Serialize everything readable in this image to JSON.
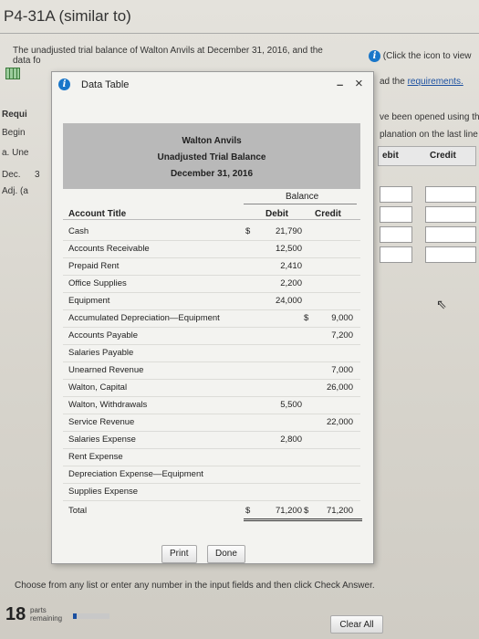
{
  "page": {
    "title": "P4-31A (similar to)",
    "question_line1": "The unadjusted trial balance of Walton Anvils at December 31, 2016, and the",
    "question_line2": "data fo",
    "click_icon_text": "(Click the icon to view",
    "read_prefix": "ad the",
    "requirements_link": "requirements.",
    "opened_text": "ve been opened using th",
    "explanation_text": "planation on the last line",
    "side_requ": "Requi",
    "side_begin": "Begin",
    "side_une": "a. Une",
    "side_dec": "Dec.",
    "side_adj": "Adj. (a",
    "side_num": "3",
    "bg_debit": "ebit",
    "bg_credit": "Credit",
    "instruction": "Choose from any list or enter any number in the input fields and then click Check Answer.",
    "parts_remaining_num": "18",
    "parts_label_1": "parts",
    "parts_label_2": "remaining",
    "progress_fraction": 0.1,
    "clear_all": "Clear All"
  },
  "modal": {
    "title": "Data Table",
    "minimize_icon": "minimize-icon",
    "close_icon": "close-icon",
    "close_glyph": "×",
    "minimize_glyph": "–",
    "company": "Walton Anvils",
    "statement": "Unadjusted Trial Balance",
    "date": "December 31, 2016",
    "balance_label": "Balance",
    "account_title_label": "Account Title",
    "debit_label": "Debit",
    "credit_label": "Credit",
    "currency": "$",
    "rows": [
      {
        "account": "Cash",
        "debit": "21,790",
        "credit": "",
        "debit_cur": true
      },
      {
        "account": "Accounts Receivable",
        "debit": "12,500",
        "credit": ""
      },
      {
        "account": "Prepaid Rent",
        "debit": "2,410",
        "credit": ""
      },
      {
        "account": "Office Supplies",
        "debit": "2,200",
        "credit": ""
      },
      {
        "account": "Equipment",
        "debit": "24,000",
        "credit": ""
      },
      {
        "account": "Accumulated Depreciation—Equipment",
        "debit": "",
        "credit": "9,000",
        "credit_cur": true
      },
      {
        "account": "Accounts Payable",
        "debit": "",
        "credit": "7,200"
      },
      {
        "account": "Salaries Payable",
        "debit": "",
        "credit": ""
      },
      {
        "account": "Unearned Revenue",
        "debit": "",
        "credit": "7,000"
      },
      {
        "account": "Walton, Capital",
        "debit": "",
        "credit": "26,000"
      },
      {
        "account": "Walton, Withdrawals",
        "debit": "5,500",
        "credit": ""
      },
      {
        "account": "Service Revenue",
        "debit": "",
        "credit": "22,000"
      },
      {
        "account": "Salaries Expense",
        "debit": "2,800",
        "credit": ""
      },
      {
        "account": "Rent Expense",
        "debit": "",
        "credit": ""
      },
      {
        "account": "Depreciation Expense—Equipment",
        "debit": "",
        "credit": ""
      },
      {
        "account": "Supplies Expense",
        "debit": "",
        "credit": ""
      }
    ],
    "total_label": "Total",
    "total_debit": "71,200",
    "total_credit": "71,200",
    "print_label": "Print",
    "done_label": "Done"
  }
}
